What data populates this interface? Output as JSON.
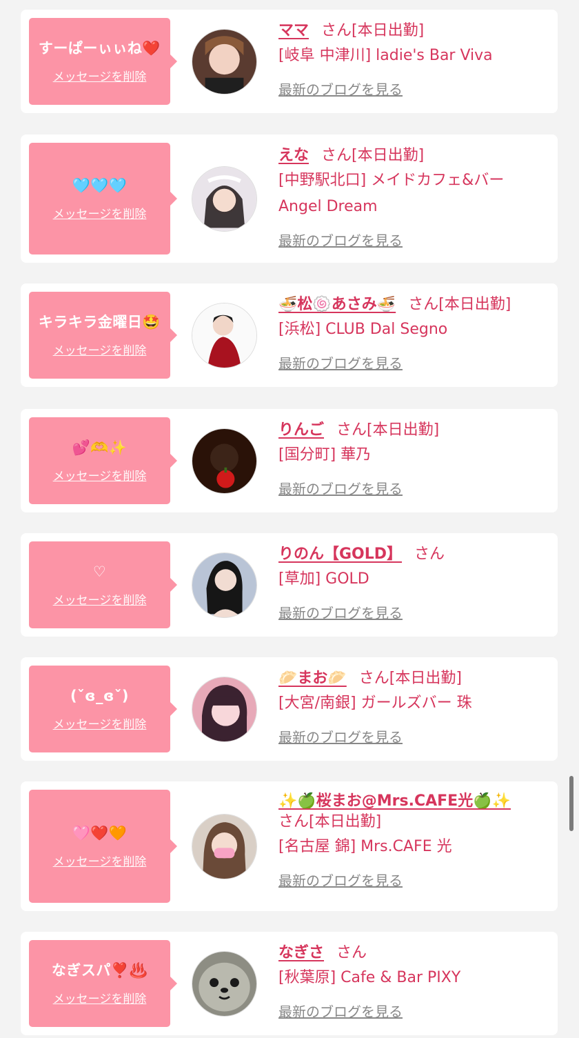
{
  "delete_label": "メッセージを削除",
  "blog_label": "最新のブログを見る",
  "entries": [
    {
      "message": "すーぱーぃぃね❤️",
      "name": "ママ",
      "suffix": "さん[本日出勤]",
      "shop": "[岐阜 中津川] ladie's Bar Viva"
    },
    {
      "message": "🩵🩵🩵",
      "name": "えな",
      "suffix": "さん[本日出勤]",
      "shop": "[中野駅北口] メイドカフェ&バー Angel Dream"
    },
    {
      "message": "キラキラ金曜日🤩",
      "name": "🍜松🍥あさみ🍜",
      "suffix": "さん[本日出勤]",
      "shop": "[浜松] CLUB Dal Segno"
    },
    {
      "message": "💕🫶✨",
      "name": "りんご",
      "suffix": "さん[本日出勤]",
      "shop": "[国分町] 華乃"
    },
    {
      "message": "♡",
      "name": "りのん【GOLD】",
      "suffix": "さん",
      "shop": "[草加] GOLD"
    },
    {
      "message": "(ˇɞ_ɞˇ)",
      "name": "🥟まお🥟",
      "suffix": "さん[本日出勤]",
      "shop": "[大宮/南銀] ガールズバー 珠"
    },
    {
      "message": "🩷❤️🧡",
      "name": "✨🍏桜まお@Mrs.CAFE光🍏✨",
      "suffix": "さん[本日出勤]",
      "shop": "[名古屋 錦] Mrs.CAFE 光"
    },
    {
      "message": "なぎスパ❣️♨️",
      "name": "なぎさ",
      "suffix": "さん",
      "shop": "[秋葉原] Cafe & Bar PIXY"
    }
  ],
  "colors": {
    "accent_pink": "#d6355c",
    "bubble_pink": "#fc94a6",
    "link_gray": "#888888",
    "background": "#f3f3f3"
  },
  "icons": [
    "avatar-photo"
  ]
}
